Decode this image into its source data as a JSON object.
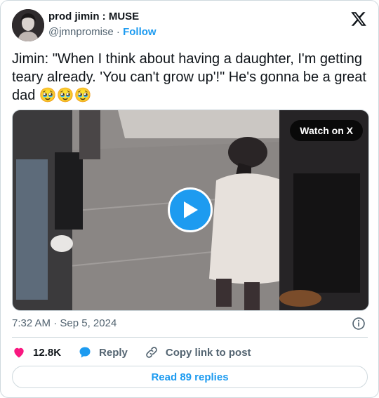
{
  "author": {
    "display_name": "prod jimin : MUSE",
    "handle": "@jmnpromise",
    "separator": "·",
    "follow_label": "Follow"
  },
  "tweet": {
    "text": "Jimin: \"When I think about having a daughter, I'm getting teary already. 'You can't grow up'!\" He's gonna be a great dad 🥹🥹🥹"
  },
  "media": {
    "watch_label": "Watch on X",
    "icon": "play-icon"
  },
  "meta": {
    "time": "7:32 AM",
    "separator": "·",
    "date": "Sep 5, 2024"
  },
  "actions": {
    "likes": "12.8K",
    "reply_label": "Reply",
    "copy_label": "Copy link to post"
  },
  "footer": {
    "read_replies": "Read 89 replies"
  },
  "colors": {
    "accent": "#1d9bf0",
    "like": "#f91880",
    "text": "#0f1419",
    "muted": "#536471",
    "border": "#cfd9de"
  }
}
